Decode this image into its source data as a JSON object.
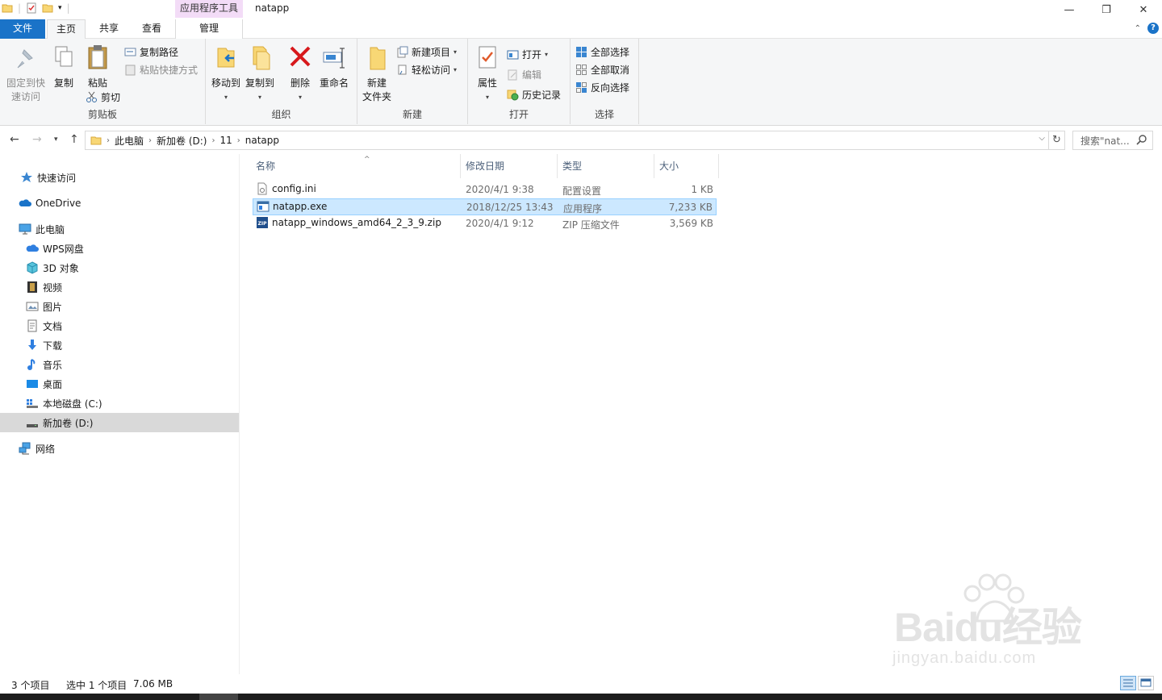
{
  "window": {
    "title": "natapp",
    "context_tab_group": "应用程序工具",
    "controls": {
      "minimize": "—",
      "maximize": "❐",
      "close": "✕"
    }
  },
  "ribbon_tabs": {
    "file": "文件",
    "home": "主页",
    "share": "共享",
    "view": "查看",
    "manage": "管理"
  },
  "ribbon": {
    "clipboard": {
      "label": "剪贴板",
      "pin_line1": "固定到快",
      "pin_line2": "速访问",
      "copy": "复制",
      "paste": "粘贴",
      "copy_path": "复制路径",
      "paste_shortcut": "粘贴快捷方式",
      "cut": "剪切"
    },
    "organize": {
      "label": "组织",
      "move_to": "移动到",
      "copy_to": "复制到",
      "delete": "删除",
      "rename": "重命名"
    },
    "new": {
      "label": "新建",
      "new_folder_line1": "新建",
      "new_folder_line2": "文件夹",
      "new_item": "新建项目",
      "easy_access": "轻松访问"
    },
    "open": {
      "label": "打开",
      "properties": "属性",
      "open": "打开",
      "edit": "编辑",
      "history": "历史记录"
    },
    "select": {
      "label": "选择",
      "select_all": "全部选择",
      "select_none": "全部取消",
      "invert": "反向选择"
    }
  },
  "address": {
    "crumbs": [
      "此电脑",
      "新加卷 (D:)",
      "11",
      "natapp"
    ],
    "search_placeholder": "搜索\"nat..."
  },
  "nav_pane": {
    "quick_access": "快速访问",
    "onedrive": "OneDrive",
    "this_pc": "此电脑",
    "wps": "WPS网盘",
    "objects3d": "3D 对象",
    "videos": "视频",
    "pictures": "图片",
    "documents": "文档",
    "downloads": "下载",
    "music": "音乐",
    "desktop": "桌面",
    "local_c": "本地磁盘 (C:)",
    "drive_d": "新加卷 (D:)",
    "network": "网络"
  },
  "columns": {
    "name": "名称",
    "modified": "修改日期",
    "type": "类型",
    "size": "大小"
  },
  "files": [
    {
      "name": "config.ini",
      "modified": "2020/4/1 9:38",
      "type": "配置设置",
      "size": "1 KB",
      "icon": "ini-file-icon",
      "selected": false
    },
    {
      "name": "natapp.exe",
      "modified": "2018/12/25 13:43",
      "type": "应用程序",
      "size": "7,233 KB",
      "icon": "exe-file-icon",
      "selected": true
    },
    {
      "name": "natapp_windows_amd64_2_3_9.zip",
      "modified": "2020/4/1 9:12",
      "type": "ZIP 压缩文件",
      "size": "3,569 KB",
      "icon": "zip-file-icon",
      "selected": false
    }
  ],
  "status": {
    "count": "3 个项目",
    "selection": "选中 1 个项目",
    "selection_size": "7.06 MB"
  },
  "watermark": {
    "brand": "Baidu经验",
    "url": "jingyan.baidu.com"
  },
  "colors": {
    "file_tab": "#1a73c8",
    "context_tab": "#f3dcf7",
    "selection_bg": "#cce8ff",
    "selection_border": "#99d1ff",
    "nav_selected": "#d9d9d9"
  }
}
